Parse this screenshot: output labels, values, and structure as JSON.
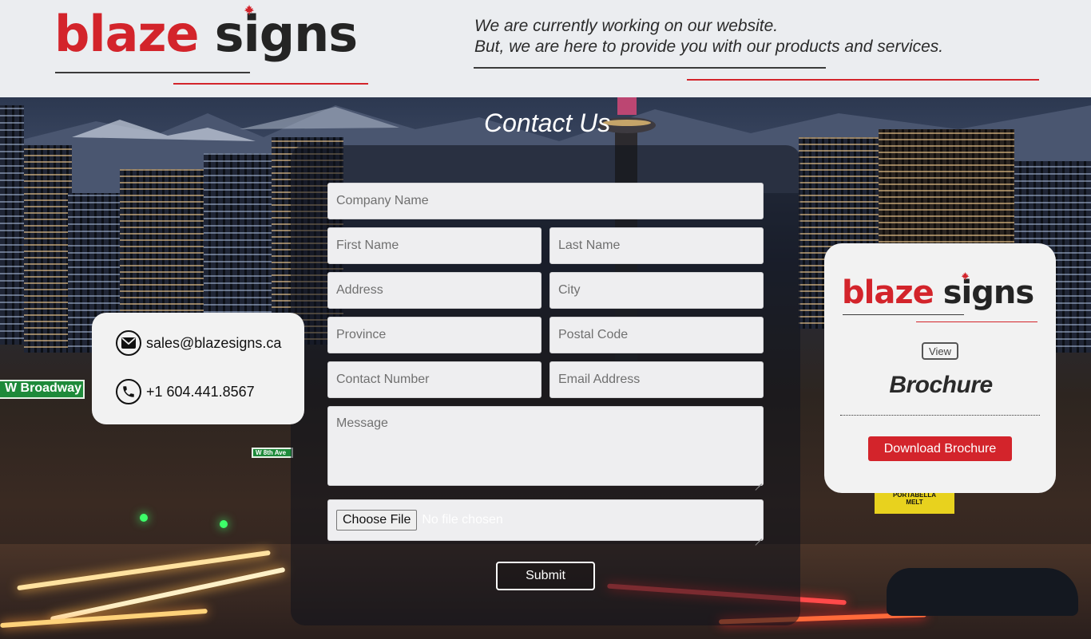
{
  "brand": {
    "word1": "blaze",
    "word2": "signs",
    "leaf_icon": "maple-leaf-icon",
    "red": "#d3242b",
    "dark": "#242424"
  },
  "header": {
    "tagline_line1": "We are currently working on our website.",
    "tagline_line2": "But, we are here to provide you with our products and services."
  },
  "background": {
    "street_sign": "W Broadway",
    "street_sign_small": "W 8th Ave",
    "shop_sign_1": "PORTABELLA",
    "shop_sign_2": "MELT"
  },
  "contact": {
    "title": "Contact Us",
    "fields": {
      "company": "Company Name",
      "first_name": "First Name",
      "last_name": "Last Name",
      "address": "Address",
      "city": "City",
      "province": "Province",
      "postal_code": "Postal Code",
      "contact_number": "Contact Number",
      "email": "Email Address",
      "message": "Message"
    },
    "file": {
      "button_label": "Choose File",
      "status": "No file chosen"
    },
    "submit_label": "Submit"
  },
  "info": {
    "email_icon": "envelope-icon",
    "email": "sales@blazesigns.ca",
    "phone_icon": "phone-icon",
    "phone": "+1 604.441.8567"
  },
  "brochure": {
    "view_label": "View",
    "title": "Brochure",
    "download_label": "Download Brochure"
  }
}
